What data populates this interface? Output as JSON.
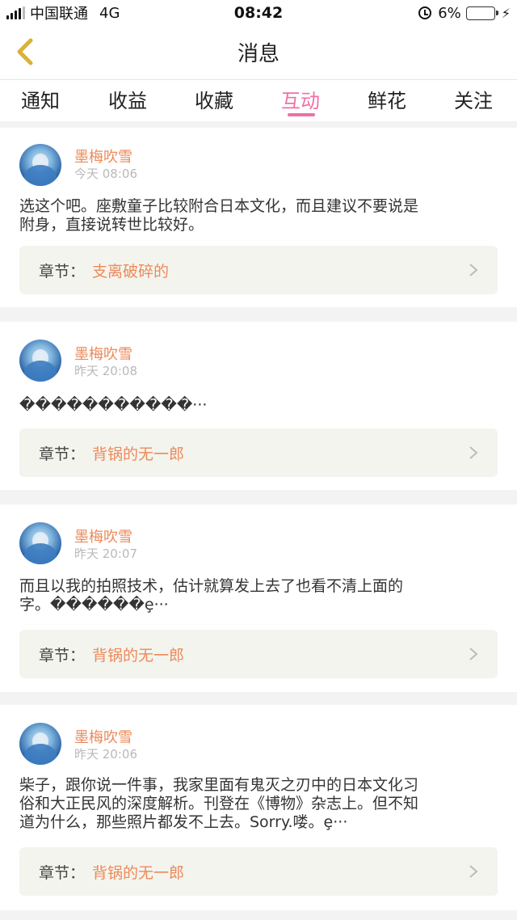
{
  "status_bar": {
    "carrier": "中国联通",
    "network": "4G",
    "time": "08:42",
    "battery": "6%"
  },
  "header": {
    "title": "消息"
  },
  "tabs": [
    {
      "label": "通知"
    },
    {
      "label": "收益"
    },
    {
      "label": "收藏"
    },
    {
      "label": "互动",
      "active": true
    },
    {
      "label": "鲜花"
    },
    {
      "label": "关注"
    }
  ],
  "chapter_prefix": "章节：",
  "messages": [
    {
      "user": "墨梅吹雪",
      "time": "今天 08:06",
      "lines": [
        "选这个吧。座敷童子比较附合日本文化，而且建议不要说是",
        "附身，直接说转世比较好。"
      ],
      "chapter": "支离破碎的"
    },
    {
      "user": "墨梅吹雪",
      "time": "昨天 20:08",
      "lines": [
        "�����������···"
      ],
      "chapter": "背锅的无一郎"
    },
    {
      "user": "墨梅吹雪",
      "time": "昨天 20:07",
      "lines": [
        "而且以我的拍照技术，估计就算发上去了也看不清上面的",
        "字。������ȩ···"
      ],
      "chapter": "背锅的无一郎"
    },
    {
      "user": "墨梅吹雪",
      "time": "昨天 20:06",
      "lines": [
        "柴子，跟你说一件事，我家里面有鬼灭之刃中的日本文化习",
        "俗和大正民风的深度解析。刊登在《博物》杂志上。但不知",
        "道为什么，那些照片都发不上去。Sorry.喽。ȩ···"
      ],
      "chapter": "背锅的无一郎"
    }
  ],
  "colors": {
    "accent_pink": "#f070a6",
    "username_orange": "#ec8a5a",
    "timestamp_gray": "#b9b9b9",
    "back_icon": "#d8b23a",
    "battery_low": "#e5322d"
  }
}
